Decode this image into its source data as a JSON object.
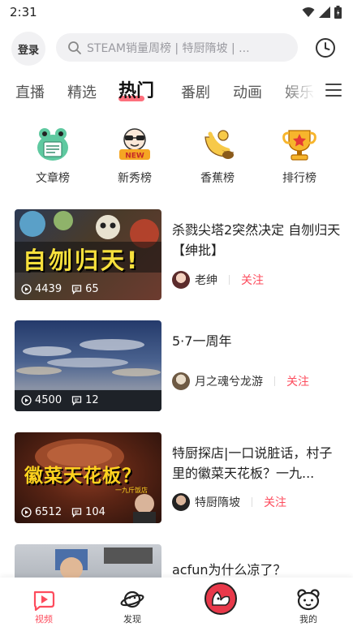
{
  "status": {
    "time": "2:31"
  },
  "header": {
    "login_label": "登录",
    "search_placeholder": "STEAM销量周榜 | 特厨隋坡 | ..."
  },
  "tabs": [
    {
      "label": "直播"
    },
    {
      "label": "精选"
    },
    {
      "label": "热门"
    },
    {
      "label": "番剧"
    },
    {
      "label": "动画"
    },
    {
      "label": "娱乐"
    }
  ],
  "categories": [
    {
      "label": "文章榜",
      "icon": "frog-article-icon"
    },
    {
      "label": "新秀榜",
      "icon": "new-badge-icon"
    },
    {
      "label": "香蕉榜",
      "icon": "banana-icon"
    },
    {
      "label": "排行榜",
      "icon": "trophy-icon"
    }
  ],
  "feed": [
    {
      "title": "杀戮尖塔2突然决定 自刎归天【绅批】",
      "thumb_text": "自刎归天!",
      "plays": "4439",
      "comments": "65",
      "author": "老绅",
      "follow_label": "关注"
    },
    {
      "title": "5·7一周年",
      "plays": "4500",
      "comments": "12",
      "author": "月之魂兮龙游",
      "follow_label": "关注"
    },
    {
      "title": "特厨探店|一口说脏话，村子里的徽菜天花板？一九...",
      "thumb_text": "徽菜天花板？",
      "thumb_subtext": "一九斤饭店",
      "plays": "6512",
      "comments": "104",
      "author": "特厨隋坡",
      "follow_label": "关注"
    },
    {
      "title": "acfun为什么凉了？"
    }
  ],
  "bottom_nav": [
    {
      "label": "视频",
      "icon": "video-icon",
      "active": true
    },
    {
      "label": "发现",
      "icon": "planet-icon",
      "active": false
    },
    {
      "label": "",
      "icon": "acfun-center-icon",
      "active": false
    },
    {
      "label": "我的",
      "icon": "bear-face-icon",
      "active": false
    }
  ],
  "colors": {
    "accent": "#fd4c5d",
    "search_bg": "#f1f1f3"
  }
}
